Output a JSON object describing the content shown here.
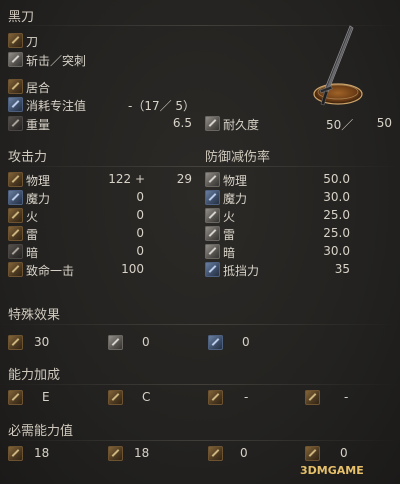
{
  "item": {
    "name": "黑刀",
    "weapon_type": "刀",
    "attack_type": "斩击／突刺",
    "skill_name": "居合",
    "fp_cost_label": "消耗专注值",
    "fp_cost_value": "-（17／ 5）",
    "weight_label": "重量",
    "weight_value": "6.5",
    "durability_label": "耐久度",
    "durability_current": "50／",
    "durability_max": "50"
  },
  "attack": {
    "heading": "攻击力",
    "rows": [
      {
        "label": "物理",
        "value": "122 +",
        "bonus": "29",
        "icon": "physical-attack-icon"
      },
      {
        "label": "魔力",
        "value": "0",
        "icon": "magic-attack-icon"
      },
      {
        "label": "火",
        "value": "0",
        "icon": "fire-attack-icon"
      },
      {
        "label": "雷",
        "value": "0",
        "icon": "lightning-attack-icon"
      },
      {
        "label": "暗",
        "value": "0",
        "icon": "dark-attack-icon"
      },
      {
        "label": "致命一击",
        "value": "100",
        "icon": "critical-icon"
      }
    ]
  },
  "defense": {
    "heading": "防御减伤率",
    "rows": [
      {
        "label": "物理",
        "value": "50.0",
        "icon": "physical-defense-icon"
      },
      {
        "label": "魔力",
        "value": "30.0",
        "icon": "magic-defense-icon"
      },
      {
        "label": "火",
        "value": "25.0",
        "icon": "fire-defense-icon"
      },
      {
        "label": "雷",
        "value": "25.0",
        "icon": "lightning-defense-icon"
      },
      {
        "label": "暗",
        "value": "30.0",
        "icon": "dark-defense-icon"
      },
      {
        "label": "抵挡力",
        "value": "35",
        "icon": "stability-icon"
      }
    ]
  },
  "effects": {
    "heading": "特殊效果",
    "values": [
      "30",
      "0",
      "0"
    ],
    "icons": [
      "bleed-icon",
      "poison-icon",
      "frost-icon"
    ]
  },
  "scaling": {
    "heading": "能力加成",
    "values": [
      "E",
      "C",
      "-",
      "-"
    ],
    "icons": [
      "strength-icon",
      "dexterity-icon",
      "intelligence-icon",
      "faith-icon"
    ]
  },
  "requirements": {
    "heading": "必需能力值",
    "values": [
      "18",
      "18",
      "0",
      "0"
    ],
    "icons": [
      "strength-req-icon",
      "dexterity-req-icon",
      "intelligence-req-icon",
      "faith-req-icon"
    ]
  },
  "watermark": "3DMGAME"
}
